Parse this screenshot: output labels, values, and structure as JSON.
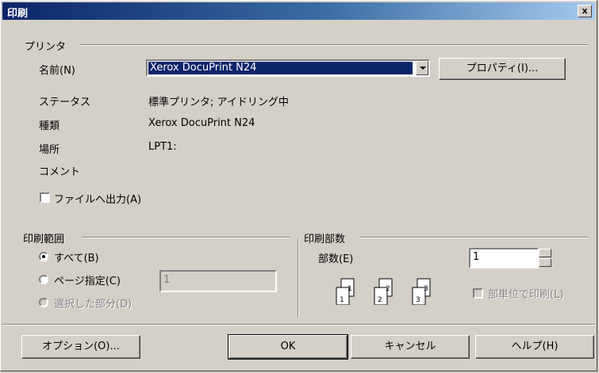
{
  "window": {
    "title": "印刷",
    "close_label": "x"
  },
  "printer": {
    "group_label": "プリンタ",
    "name_label": "名前(N)",
    "name_value": "Xerox DocuPrint N24",
    "properties_label": "プロパティ(I)...",
    "status_label": "ステータス",
    "status_value": "標準プリンタ; アイドリング中",
    "type_label": "種類",
    "type_value": "Xerox DocuPrint N24",
    "location_label": "場所",
    "location_value": "LPT1:",
    "comment_label": "コメント",
    "print_to_file_label": "ファイルへ出力(A)"
  },
  "range": {
    "group_label": "印刷範囲",
    "all_label": "すべて(B)",
    "pages_label": "ページ指定(C)",
    "pages_value": "1",
    "selection_label": "選択した部分(D)"
  },
  "copies": {
    "group_label": "印刷部数",
    "count_label": "部数(E)",
    "count_value": "1",
    "collate_label": "部単位で印刷(L)",
    "icons": [
      "1",
      "1",
      "2",
      "2",
      "3",
      "3"
    ]
  },
  "buttons": {
    "options": "オプション(O)...",
    "ok": "OK",
    "cancel": "キャンセル",
    "help": "ヘルプ(H)"
  }
}
